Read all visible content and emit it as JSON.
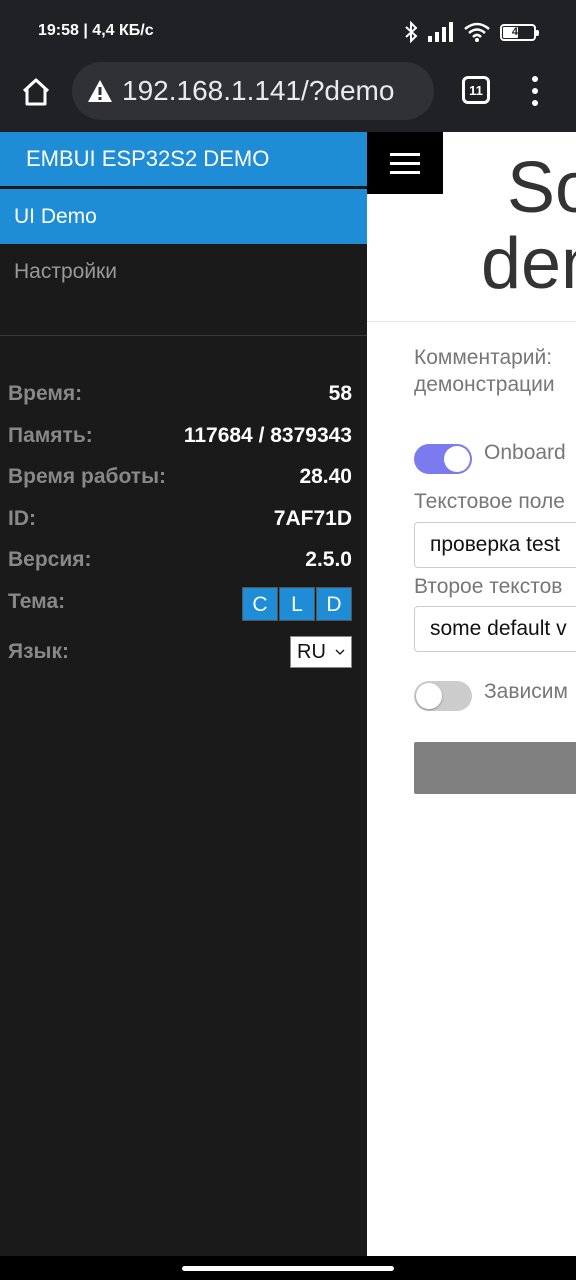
{
  "status_bar": {
    "time": "19:58 | 4,4 КБ/с",
    "battery": "46",
    "battery_level": 0.46
  },
  "browser": {
    "url": "192.168.1.141/?demo",
    "tabs_count": "11"
  },
  "sidebar": {
    "header": "EMBUI ESP32S2 DEMO",
    "items": [
      {
        "label": "UI Demo",
        "active": true
      },
      {
        "label": "Настройки",
        "active": false
      }
    ],
    "stats": [
      {
        "label": "Время:",
        "value": "58"
      },
      {
        "label": "Память:",
        "value": "117684 / 8379343"
      },
      {
        "label": "Время работы:",
        "value": "28.40"
      },
      {
        "label": "ID:",
        "value": "7AF71D"
      },
      {
        "label": "Версия:",
        "value": "2.5.0"
      }
    ],
    "theme": {
      "label": "Тема:",
      "options": [
        "C",
        "L",
        "D"
      ]
    },
    "language": {
      "label": "Язык:",
      "selected": "RU"
    }
  },
  "main": {
    "title_line1": "Some",
    "title_line2": "demo",
    "comment_line1": "Комментарий:",
    "comment_line2": "демонстрации",
    "toggle1_label": "Onboard",
    "toggle1_on": true,
    "field1_label": "Текстовое поле",
    "field1_value": "проверка test",
    "field2_label": "Второе текстов",
    "field2_value": "some default v",
    "toggle2_label": "Зависим",
    "toggle2_on": false
  },
  "colors": {
    "accent": "#1f8dd6",
    "sidebar_bg": "#1a1a1a",
    "toggle_on": "#7b7bef"
  }
}
